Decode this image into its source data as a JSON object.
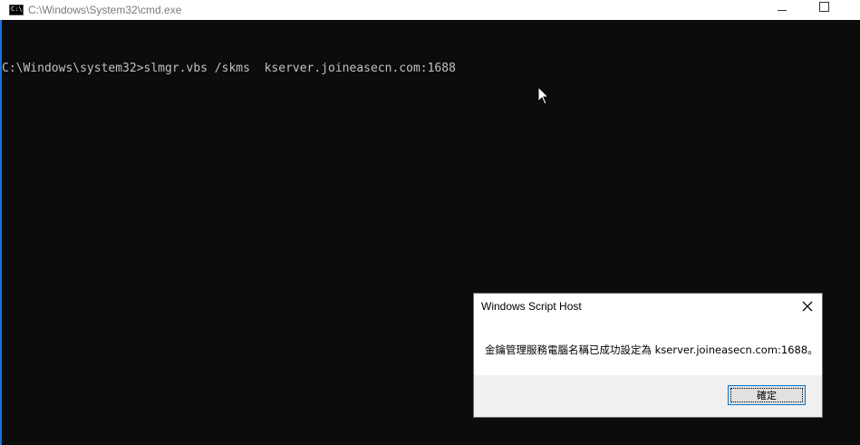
{
  "window": {
    "title": "C:\\Windows\\System32\\cmd.exe",
    "icon": "cmd-console-icon",
    "icon_text": "C:\\"
  },
  "console": {
    "lines": [
      "C:\\Windows\\system32>slmgr.vbs /skms  kserver.joineasecn.com:1688"
    ]
  },
  "dialog": {
    "title": "Windows Script Host",
    "message": "金鑰管理服務電腦名稱已成功設定為 kserver.joineasecn.com:1688。",
    "ok_label": "確定"
  },
  "colors": {
    "console_bg": "#0c0c0c",
    "console_text": "#c0c0c0",
    "accent": "#0078d7"
  }
}
